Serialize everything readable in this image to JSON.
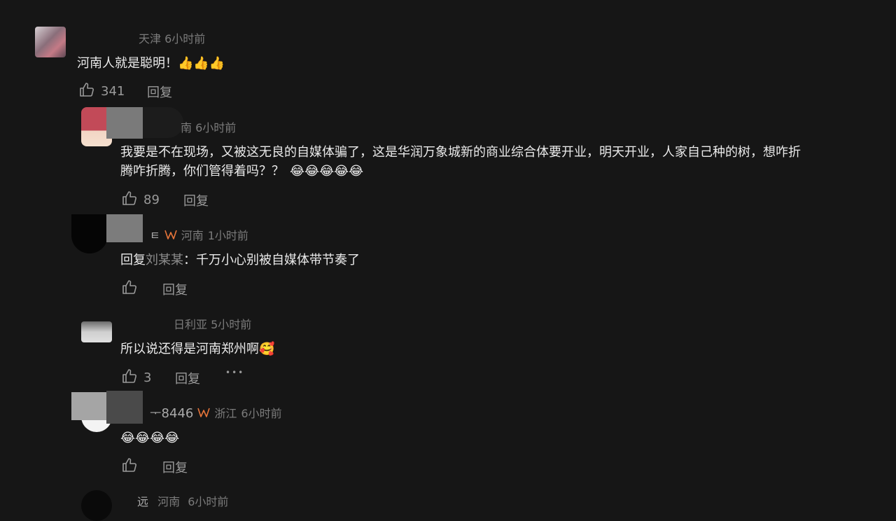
{
  "comments": [
    {
      "username_tail": "天津",
      "location": "",
      "time": "6小时前",
      "text": "河南人就是聪明！",
      "emoji": "👍👍👍",
      "likes": "341",
      "reply_label": "回复"
    },
    {
      "username_tail": "南",
      "location": "",
      "time": "6小时前",
      "text_line1": "我要是不在现场，又被这无良的自媒体骗了，这是华润万象城新的商业综合体要开业，明天开业，人家自己种的树，想咋折",
      "text_line2": "腾咋折腾，你们管得着吗？？",
      "emoji": "😂😂😂😂😂",
      "likes": "89",
      "reply_label": "回复"
    },
    {
      "username_tail": "ㅌ",
      "location": "河南",
      "time": "1小时前",
      "reply_prefix": "回复",
      "reply_to": "刘某某",
      "text": "：千万小心别被自媒体带节奏了",
      "likes": "",
      "reply_label": "回复"
    },
    {
      "username_tail": "日利亚",
      "location": "",
      "time": "5小时前",
      "text": "所以说还得是河南郑州啊",
      "emoji": "🥰",
      "likes": "3",
      "reply_label": "回复",
      "more": "•••"
    },
    {
      "username_tail": "ᅮ8446",
      "location": "浙江",
      "time": "6小时前",
      "emoji": "😂😂😂😂",
      "likes": "",
      "reply_label": "回复"
    },
    {
      "username_tail": "远",
      "location": "河南",
      "time": "6小时前"
    }
  ],
  "colors": {
    "background": "#161616",
    "text": "#ebebeb",
    "meta": "#7b7b7b",
    "vip_badge": "#e8753a"
  },
  "icons": [
    "thumbs-up-icon",
    "vip-badge-icon",
    "more-icon"
  ]
}
